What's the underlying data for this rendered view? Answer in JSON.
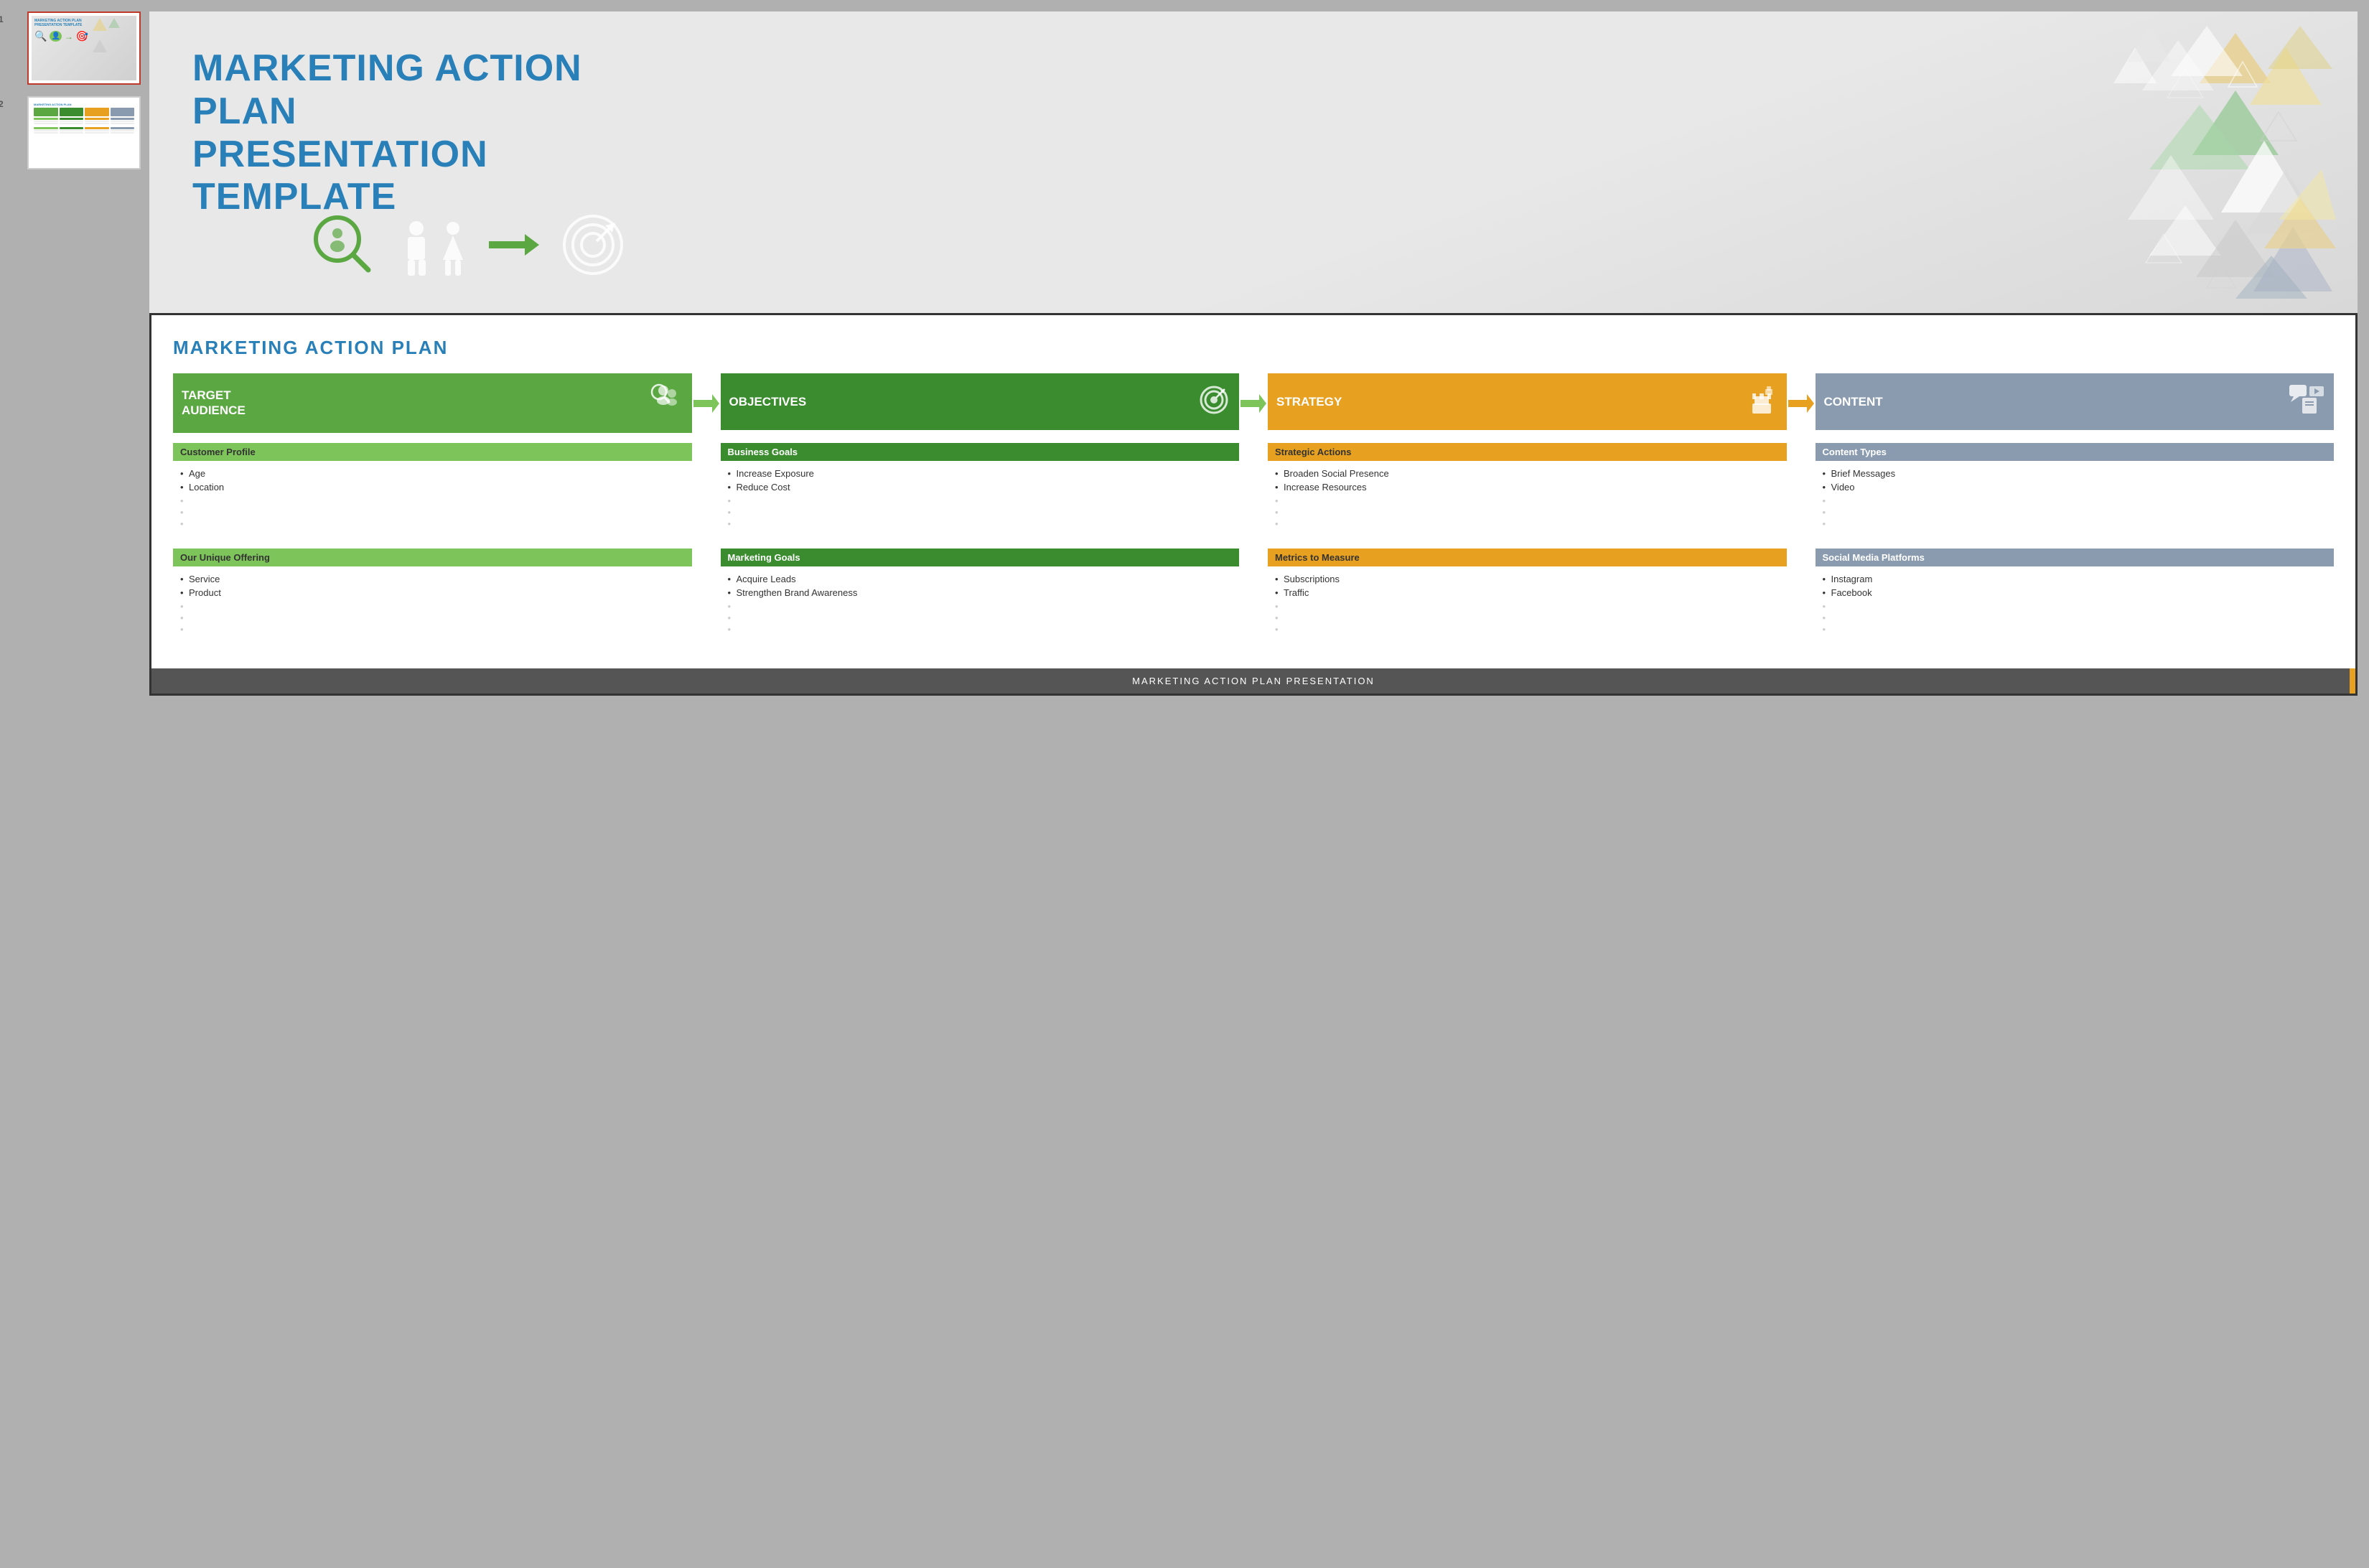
{
  "sidebar": {
    "slides": [
      {
        "number": "1",
        "label": "title-slide",
        "active": true
      },
      {
        "number": "2",
        "label": "map-slide",
        "active": false
      }
    ]
  },
  "slide1": {
    "title_line1": "MARKETING ACTION PLAN",
    "title_line2": "PRESENTATION TEMPLATE"
  },
  "slide2": {
    "main_title": "MARKETING ACTION PLAN",
    "footer_text": "MARKETING ACTION PLAN PRESENTATION",
    "columns": [
      {
        "id": "target-audience",
        "header": "TARGET AUDIENCE",
        "color": "green",
        "icon": "👥",
        "sections": [
          {
            "label": "Customer Profile",
            "color": "light-green",
            "items": [
              "Age",
              "Location",
              "",
              "",
              ""
            ]
          },
          {
            "label": "Our Unique Offering",
            "color": "light-green",
            "items": [
              "Service",
              "Product",
              "",
              "",
              ""
            ]
          }
        ]
      },
      {
        "id": "objectives",
        "header": "OBJECTIVES",
        "color": "dark-green",
        "icon": "🎯",
        "sections": [
          {
            "label": "Business Goals",
            "color": "dark-green-h",
            "items": [
              "Increase Exposure",
              "Reduce Cost",
              "",
              "",
              ""
            ]
          },
          {
            "label": "Marketing Goals",
            "color": "dark-green-h",
            "items": [
              "Acquire Leads",
              "Strengthen Brand Awareness",
              "",
              "",
              ""
            ]
          }
        ]
      },
      {
        "id": "strategy",
        "header": "STRATEGY",
        "color": "yellow",
        "icon": "♟",
        "sections": [
          {
            "label": "Strategic Actions",
            "color": "yellow-h",
            "items": [
              "Broaden Social Presence",
              "Increase Resources",
              "",
              "",
              ""
            ]
          },
          {
            "label": "Metrics to Measure",
            "color": "yellow-h",
            "items": [
              "Subscriptions",
              "Traffic",
              "",
              "",
              ""
            ]
          }
        ]
      },
      {
        "id": "content",
        "header": "CONTENT",
        "color": "steel",
        "icon": "📋",
        "sections": [
          {
            "label": "Content Types",
            "color": "steel-h",
            "items": [
              "Brief Messages",
              "Video",
              "",
              "",
              ""
            ]
          },
          {
            "label": "Social Media Platforms",
            "color": "steel-h",
            "items": [
              "Instagram",
              "Facebook",
              "",
              "",
              ""
            ]
          }
        ]
      }
    ],
    "arrows": [
      {
        "color": "#7dc45a",
        "char": "➤"
      },
      {
        "color": "#7dc45a",
        "char": "➤"
      },
      {
        "color": "#e8a020",
        "char": "➤"
      }
    ]
  }
}
